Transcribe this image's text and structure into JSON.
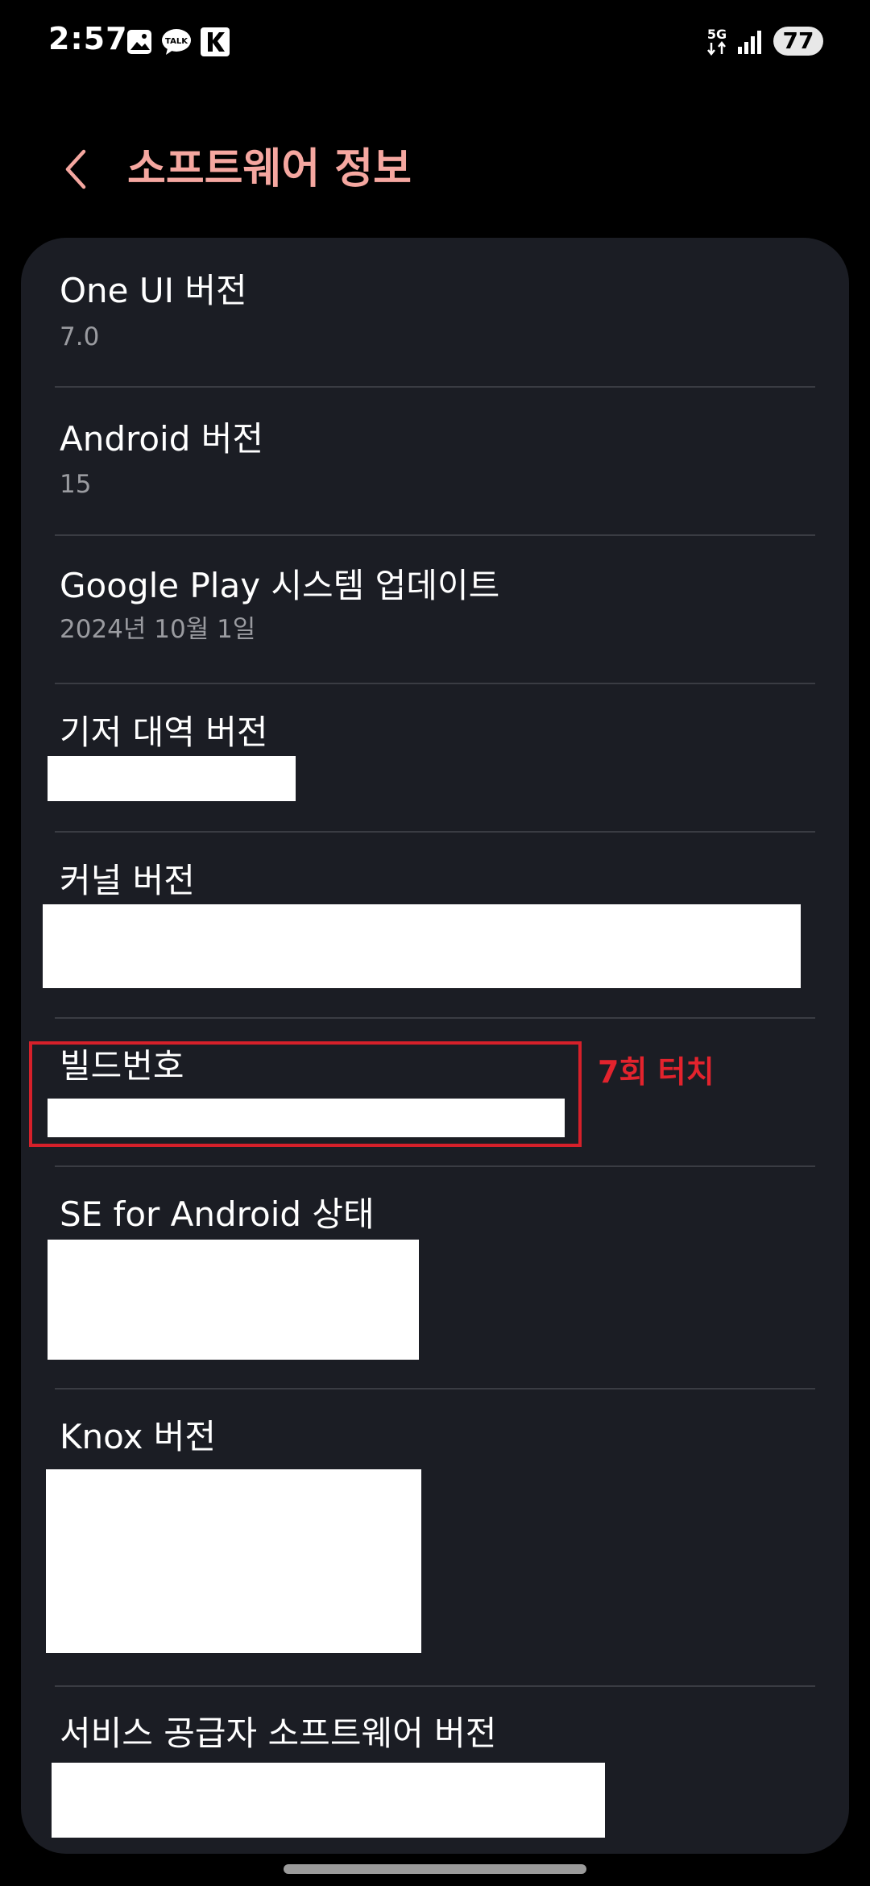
{
  "status_bar": {
    "time": "2:57",
    "left_icons": [
      "gallery-icon",
      "kakaotalk-icon",
      "k-app-icon"
    ],
    "talk_icon_label": "TALK",
    "network": "5G",
    "battery": "77"
  },
  "header": {
    "back_icon": "chevron-left-icon",
    "title": "소프트웨어 정보"
  },
  "items": [
    {
      "title": "One UI 버전",
      "value": "7.0"
    },
    {
      "title": "Android 버전",
      "value": "15"
    },
    {
      "title": "Google Play 시스템 업데이트",
      "value": "2024년 10월 1일"
    },
    {
      "title": "기저 대역 버전",
      "value": ""
    },
    {
      "title": "커널 버전",
      "value": ""
    },
    {
      "title": "빌드번호",
      "value": ""
    },
    {
      "title": "SE for Android 상태",
      "value": ""
    },
    {
      "title": "Knox 버전",
      "value": ""
    },
    {
      "title": "서비스 공급자 소프트웨어 버전",
      "value": ""
    }
  ],
  "annotation": {
    "text": "7회 터치",
    "target": "빌드번호"
  },
  "colors": {
    "background": "#000000",
    "card": "#1b1d24",
    "title_accent": "#f5a7a0",
    "annotation_red": "#e3232d",
    "secondary_text": "#9a9ba0"
  }
}
